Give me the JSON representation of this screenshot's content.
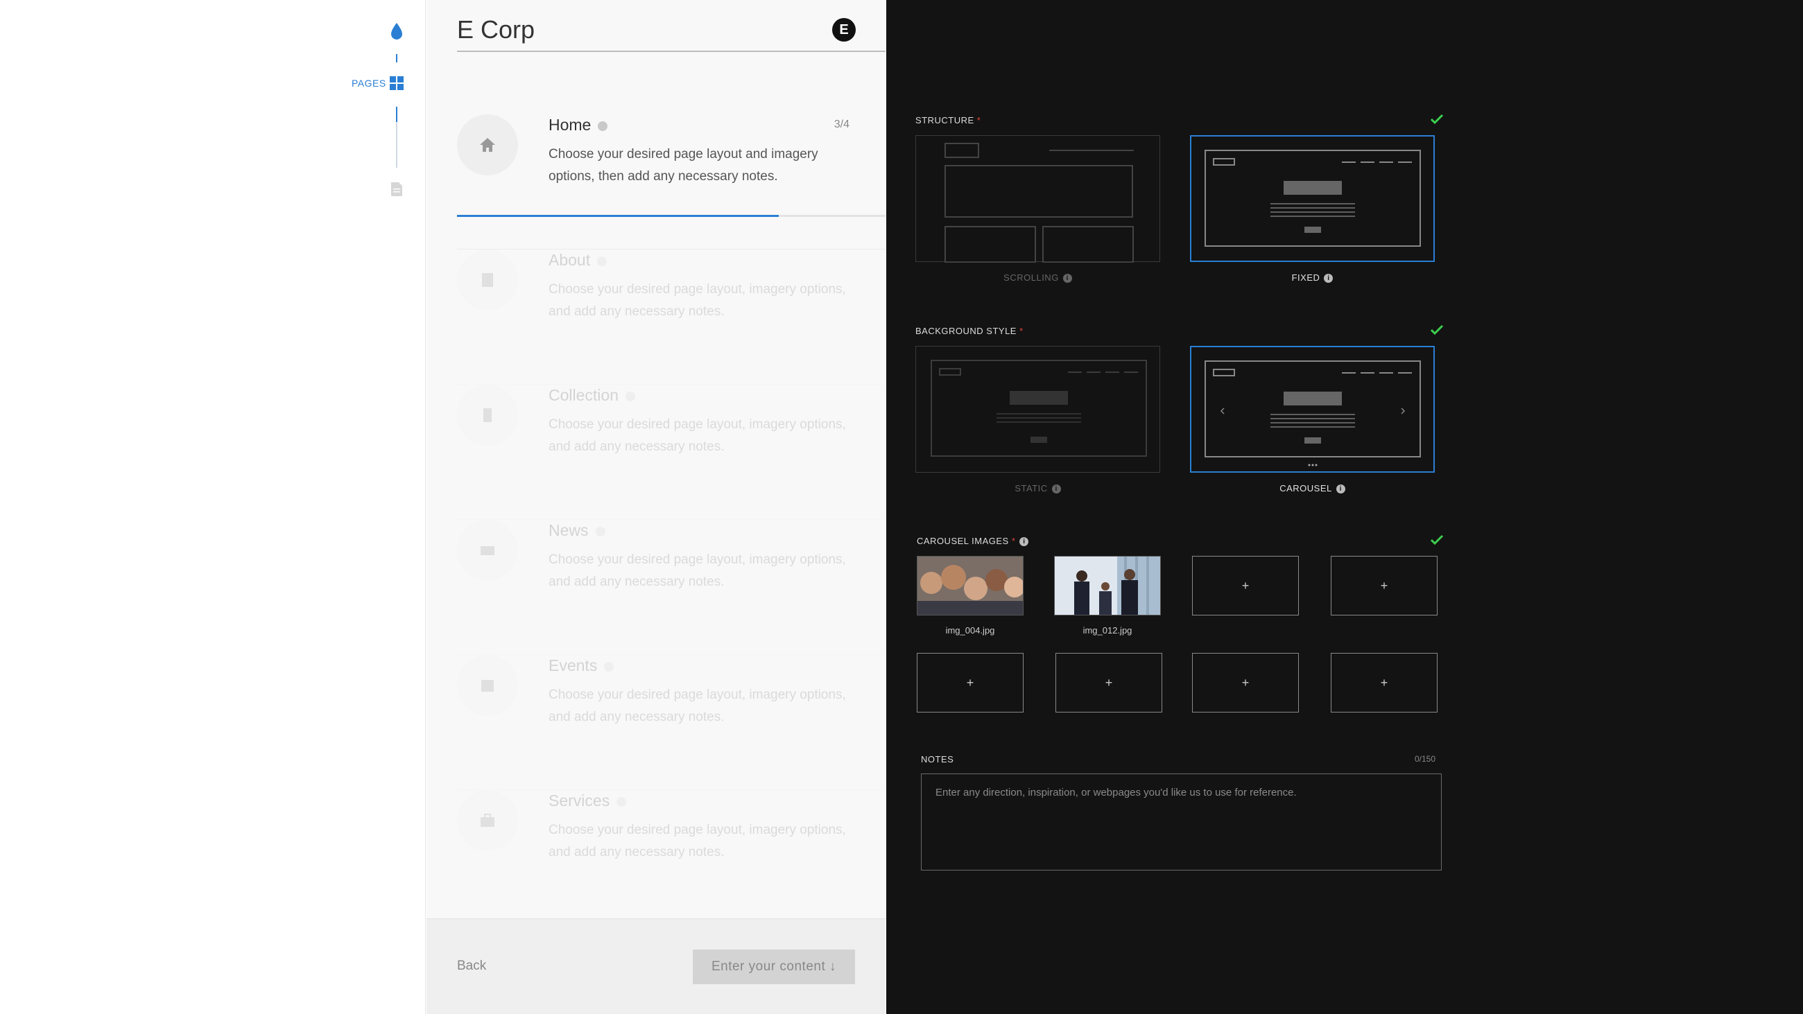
{
  "rail": {
    "pages_label": "PAGES"
  },
  "brand": {
    "title": "E Corp",
    "logo_letter": "E"
  },
  "pages": [
    {
      "title": "Home",
      "description": "Choose your desired page layout and imagery options, then add any necessary notes.",
      "count": "3/4",
      "progress": 0.75
    },
    {
      "title": "About",
      "description": "Choose your desired page layout, imagery options, and add any necessary notes."
    },
    {
      "title": "Collection",
      "description": "Choose your desired page layout, imagery options, and add any necessary notes."
    },
    {
      "title": "News",
      "description": "Choose your desired page layout, imagery options, and add any necessary notes."
    },
    {
      "title": "Events",
      "description": "Choose your desired page layout, imagery options, and add any necessary notes."
    },
    {
      "title": "Services",
      "description": "Choose your desired page layout, imagery options, and add any necessary notes."
    }
  ],
  "footer": {
    "back_label": "Back",
    "continue_label": "Enter your content"
  },
  "structure": {
    "label": "STRUCTURE",
    "required_mark": "*",
    "options": [
      {
        "label": "SCROLLING",
        "selected": false
      },
      {
        "label": "FIXED",
        "selected": true
      }
    ]
  },
  "background_style": {
    "label": "BACKGROUND STYLE",
    "required_mark": "*",
    "options": [
      {
        "label": "STATIC",
        "selected": false
      },
      {
        "label": "CAROUSEL",
        "selected": true
      }
    ]
  },
  "carousel_images": {
    "label": "CAROUSEL IMAGES",
    "required_mark": "*",
    "add_symbol": "+",
    "images": [
      {
        "name": "img_004.jpg"
      },
      {
        "name": "img_012.jpg"
      }
    ]
  },
  "notes": {
    "label": "NOTES",
    "count": "0/150",
    "placeholder": "Enter any direction, inspiration, or webpages you'd like us to use for reference."
  },
  "colors": {
    "accent": "#2a7fd4",
    "check": "#3ccf4e",
    "required": "#e0443f",
    "dark_bg": "#131313"
  }
}
